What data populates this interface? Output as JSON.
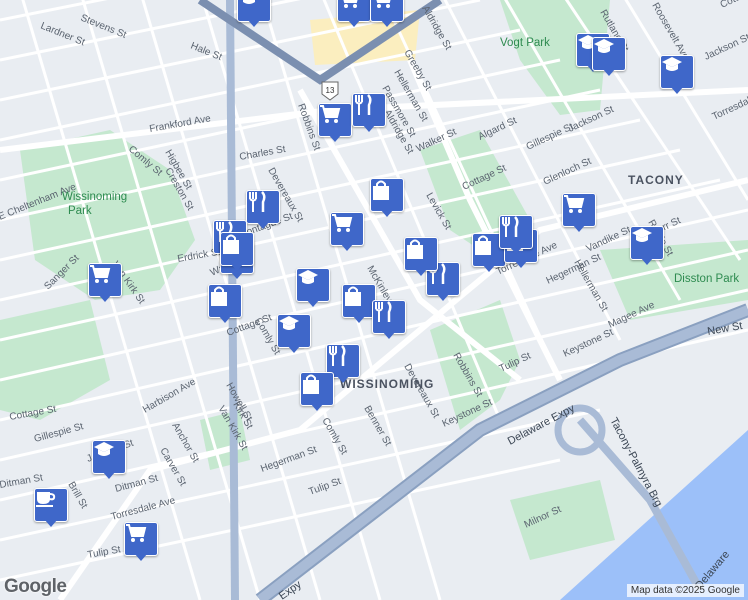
{
  "map": {
    "streets": [
      "Lardner St",
      "Stevens St",
      "Hale St",
      "Frankford Ave",
      "Comly St",
      "Higbee St",
      "Creston St",
      "E Cheltenham Ave",
      "Charles St",
      "Devereaux St",
      "Montague St",
      "Erdrick St",
      "Walker St",
      "Van Kirk St",
      "Sanger St",
      "Cottage St",
      "Comly St",
      "Howell St",
      "Van Kirk St",
      "Cottage St",
      "Gillespie St",
      "Jackson St",
      "Harbison Ave",
      "Anchor St",
      "Carver St",
      "Ditman St",
      "Brill St",
      "Torresdale Ave",
      "Tulip St",
      "Hegerman St",
      "Comly St",
      "Benner St",
      "Tulip St",
      "Robbins St",
      "Greeby St",
      "Hellerman St",
      "Passmore St",
      "Aldridge St",
      "Algard St",
      "Walker St",
      "Cottage St",
      "Gillespie St",
      "Jackson St",
      "Glenloch St",
      "Levick St",
      "Torresdale Ave",
      "Vandike St",
      "Knorr St",
      "Hegerman St",
      "Hellerman St",
      "Robbins St",
      "Magee Ave",
      "Keystone St",
      "Tulip St",
      "Devereaux St",
      "Keystone St",
      "Milnor St",
      "McKinley St",
      "Torresdale",
      "Jackson St",
      "Ditman St",
      "Roosevelt Ave",
      "Aldridge St",
      "Cottage St",
      "Kirk St",
      "Rawle St",
      "Rutland St"
    ],
    "neighborhoods": [
      "TACONY",
      "WISSINOMING"
    ],
    "parks": [
      "Wissinoming Park",
      "Vogt Park",
      "Disston Park"
    ],
    "highways": [
      "Delaware Expy",
      "Tacony-Palmyra Brg",
      "New St",
      "Expy",
      "Delaware"
    ],
    "route_shield": "13",
    "attribution": "Map data ©2025 Google",
    "logo": "Google",
    "markers": [
      {
        "type": "school",
        "icon": "graduation-cap-icon"
      },
      {
        "type": "grocery",
        "icon": "shopping-cart-icon"
      },
      {
        "type": "grocery",
        "icon": "shopping-cart-icon"
      },
      {
        "type": "school",
        "icon": "graduation-cap-icon"
      },
      {
        "type": "school",
        "icon": "graduation-cap-icon"
      },
      {
        "type": "school",
        "icon": "graduation-cap-icon"
      },
      {
        "type": "grocery",
        "icon": "shopping-cart-icon"
      },
      {
        "type": "restaurant",
        "icon": "fork-knife-icon"
      },
      {
        "type": "shopping",
        "icon": "shopping-bag-icon"
      },
      {
        "type": "restaurant",
        "icon": "fork-knife-icon"
      },
      {
        "type": "grocery",
        "icon": "shopping-cart-icon"
      },
      {
        "type": "shopping",
        "icon": "shopping-bag-icon"
      },
      {
        "type": "restaurant",
        "icon": "fork-knife-icon"
      },
      {
        "type": "restaurant",
        "icon": "fork-knife-icon"
      },
      {
        "type": "grocery",
        "icon": "shopping-cart-icon"
      },
      {
        "type": "grocery",
        "icon": "shopping-cart-icon"
      },
      {
        "type": "school",
        "icon": "graduation-cap-icon"
      },
      {
        "type": "shopping",
        "icon": "shopping-bag-icon"
      },
      {
        "type": "restaurant",
        "icon": "fork-knife-icon"
      },
      {
        "type": "shopping",
        "icon": "shopping-bag-icon"
      },
      {
        "type": "shopping",
        "icon": "shopping-bag-icon"
      },
      {
        "type": "restaurant",
        "icon": "fork-knife-icon"
      },
      {
        "type": "shopping",
        "icon": "shopping-bag-icon"
      },
      {
        "type": "restaurant",
        "icon": "fork-knife-icon"
      },
      {
        "type": "school",
        "icon": "graduation-cap-icon"
      },
      {
        "type": "school",
        "icon": "graduation-cap-icon"
      },
      {
        "type": "restaurant",
        "icon": "fork-knife-icon"
      },
      {
        "type": "shopping",
        "icon": "shopping-bag-icon"
      },
      {
        "type": "school",
        "icon": "graduation-cap-icon"
      },
      {
        "type": "cafe",
        "icon": "coffee-cup-icon"
      },
      {
        "type": "grocery",
        "icon": "shopping-cart-icon"
      },
      {
        "type": "shopping",
        "icon": "shopping-bag-icon"
      }
    ]
  }
}
